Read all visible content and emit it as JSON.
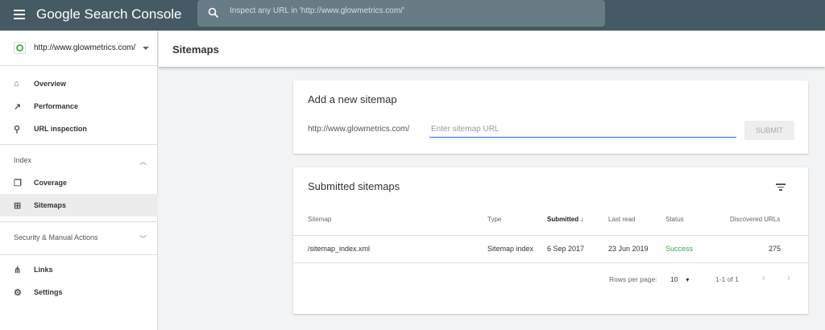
{
  "header": {
    "app_title": "Google Search Console",
    "search_placeholder": "Inspect any URL in 'http://www.glowmetrics.com/'"
  },
  "sidebar": {
    "property": "http://www.glowmetrics.com/",
    "items": [
      {
        "label": "Overview"
      },
      {
        "label": "Performance"
      },
      {
        "label": "URL inspection"
      },
      {
        "label": "Coverage"
      },
      {
        "label": "Sitemaps"
      },
      {
        "label": "Links"
      },
      {
        "label": "Settings"
      }
    ],
    "sections": {
      "index": "Index",
      "security": "Security & Manual Actions"
    }
  },
  "page": {
    "title": "Sitemaps"
  },
  "add_card": {
    "title": "Add a new sitemap",
    "prefix": "http://www.glowmetrics.com/",
    "placeholder": "Enter sitemap URL",
    "submit": "SUBMIT"
  },
  "submitted": {
    "title": "Submitted sitemaps",
    "columns": [
      "Sitemap",
      "Type",
      "Submitted",
      "Last read",
      "Status",
      "Discovered URLs"
    ],
    "rows": [
      {
        "sitemap": "/sitemap_index.xml",
        "type": "Sitemap index",
        "submitted": "6 Sep 2017",
        "last_read": "23 Jun 2019",
        "status": "Success",
        "discovered": "275"
      }
    ],
    "rows_per_page_label": "Rows per page:",
    "rows_per_page": "10",
    "range": "1-1 of 1"
  },
  "colors": {
    "header": "#455a64",
    "success": "#34a853",
    "accent": "#1a73e8"
  }
}
